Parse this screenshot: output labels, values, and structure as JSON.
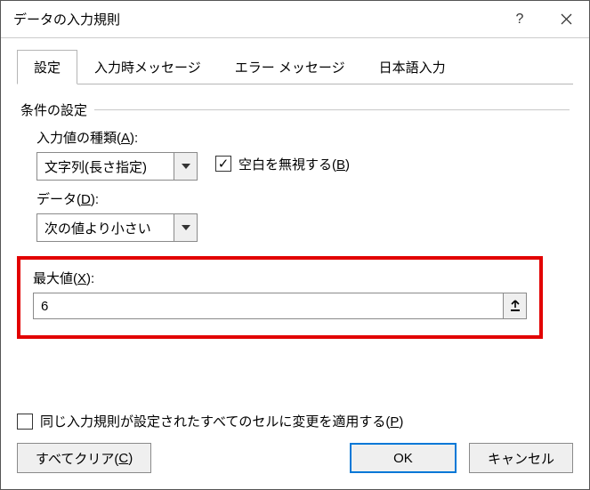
{
  "title": "データの入力規則",
  "tabs": {
    "settings": "設定",
    "inputMsg": "入力時メッセージ",
    "errorMsg": "エラー メッセージ",
    "ime": "日本語入力"
  },
  "group": {
    "title": "条件の設定"
  },
  "allowLabelPrefix": "入力値の種類(",
  "allowLabelKey": "A",
  "allowLabelSuffix": "):",
  "allowValue": "文字列(長さ指定)",
  "ignoreBlankPrefix": "空白を無視する(",
  "ignoreBlankKey": "B",
  "ignoreBlankSuffix": ")",
  "dataLabelPrefix": "データ(",
  "dataLabelKey": "D",
  "dataLabelSuffix": "):",
  "dataValue": "次の値より小さい",
  "maxLabelPrefix": "最大値(",
  "maxLabelKey": "X",
  "maxLabelSuffix": "):",
  "maxValue": "6",
  "applyPrefix": "同じ入力規則が設定されたすべてのセルに変更を適用する(",
  "applyKey": "P",
  "applySuffix": ")",
  "clearPrefix": "すべてクリア(",
  "clearKey": "C",
  "clearSuffix": ")",
  "ok": "OK",
  "cancel": "キャンセル"
}
